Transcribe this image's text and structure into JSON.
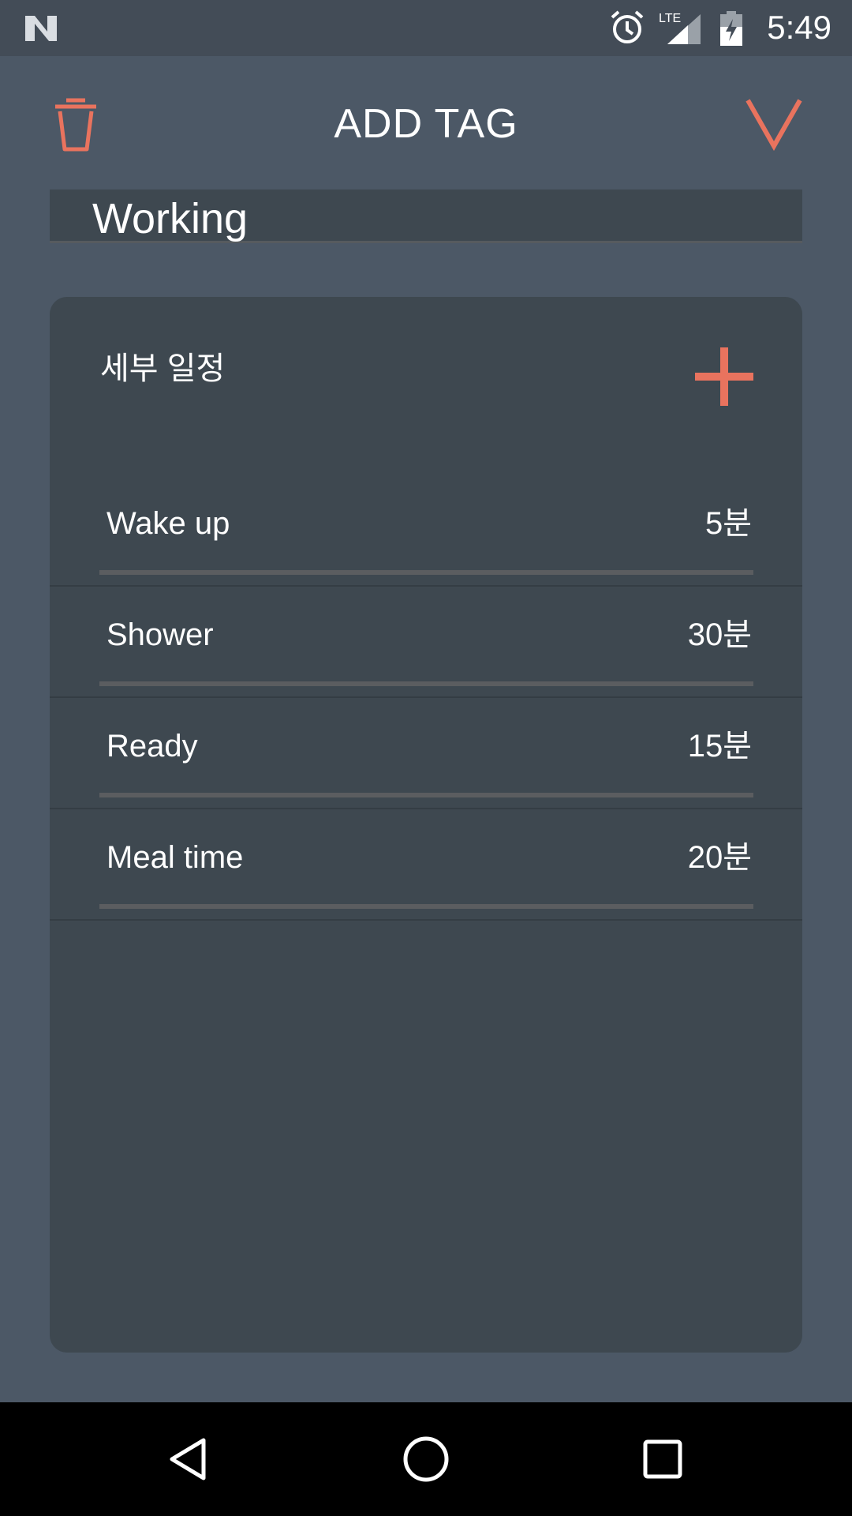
{
  "status_bar": {
    "time": "5:49",
    "network_label": "LTE",
    "icons": [
      "n-logo-icon",
      "alarm-icon",
      "lte-signal-icon",
      "battery-charging-icon"
    ]
  },
  "header": {
    "title": "ADD TAG",
    "left_icon": "trash-icon",
    "right_icon": "check-v-icon"
  },
  "name_field": {
    "value": "Working"
  },
  "schedule": {
    "title": "세부 일정",
    "add_icon": "plus-icon",
    "items": [
      {
        "label": "Wake up",
        "duration": "5분"
      },
      {
        "label": "Shower",
        "duration": "30분"
      },
      {
        "label": "Ready",
        "duration": "15분"
      },
      {
        "label": "Meal time",
        "duration": "20분"
      }
    ]
  },
  "nav_bar": {
    "icons": [
      "back-triangle-icon",
      "home-circle-icon",
      "recents-square-icon"
    ]
  },
  "colors": {
    "accent": "#e9735e",
    "background": "#4c5866",
    "card": "#3e4850",
    "status_bar": "#434c57"
  }
}
